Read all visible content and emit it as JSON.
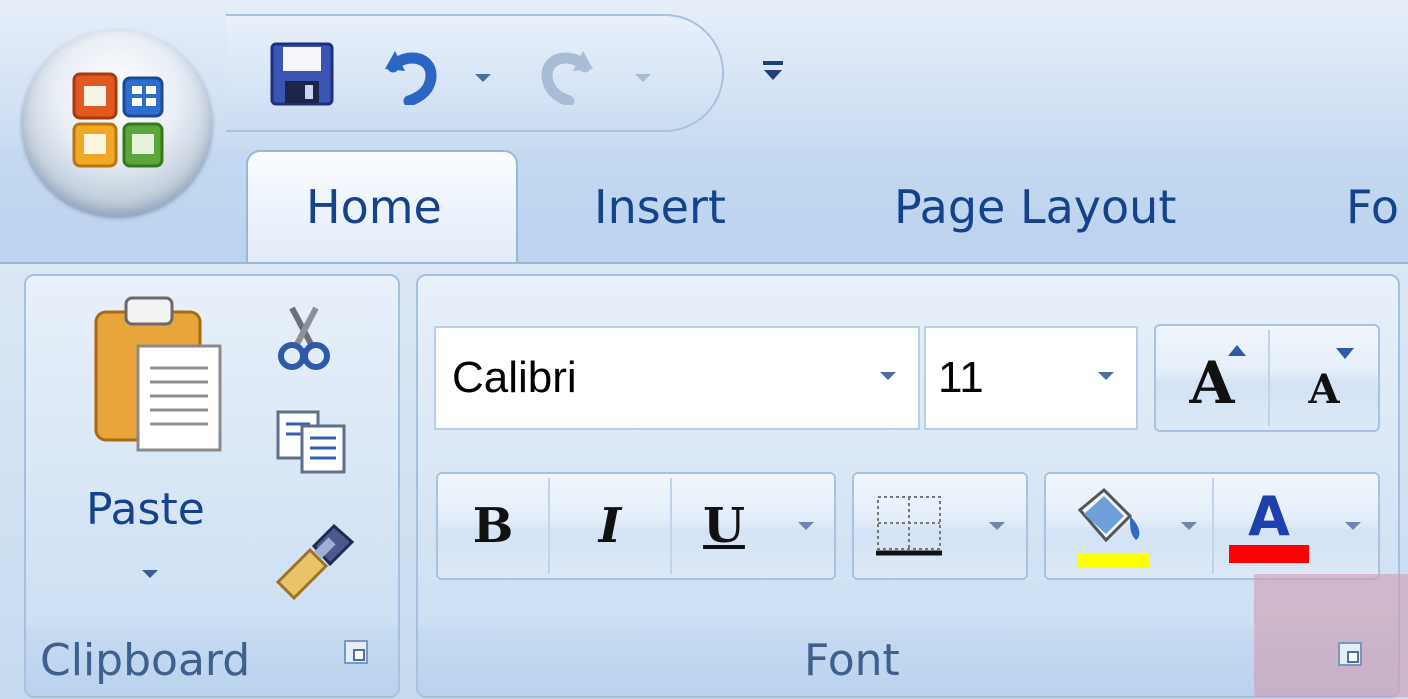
{
  "app": {
    "name": "Microsoft Office 2007 Ribbon"
  },
  "quick_access": {
    "items": [
      "save-icon",
      "undo-icon",
      "redo-icon",
      "customize-icon"
    ]
  },
  "tabs": [
    {
      "label": "Home",
      "active": true
    },
    {
      "label": "Insert",
      "active": false
    },
    {
      "label": "Page Layout",
      "active": false
    },
    {
      "label": "Fo",
      "active": false
    }
  ],
  "clipboard": {
    "paste_label": "Paste",
    "group_label": "Clipboard",
    "icons": [
      "cut-icon",
      "copy-icon",
      "format-painter-icon"
    ]
  },
  "font": {
    "font_name": "Calibri",
    "font_size": "11",
    "group_label": "Font",
    "bold_label": "B",
    "italic_label": "I",
    "underline_label": "U",
    "grow_label": "A",
    "shrink_label": "A",
    "font_color_label": "A",
    "highlight_color": "#ffff00",
    "font_color": "#ff0000"
  },
  "colors": {
    "accent_text": "#15428b",
    "group_label": "#3f5f8f"
  }
}
